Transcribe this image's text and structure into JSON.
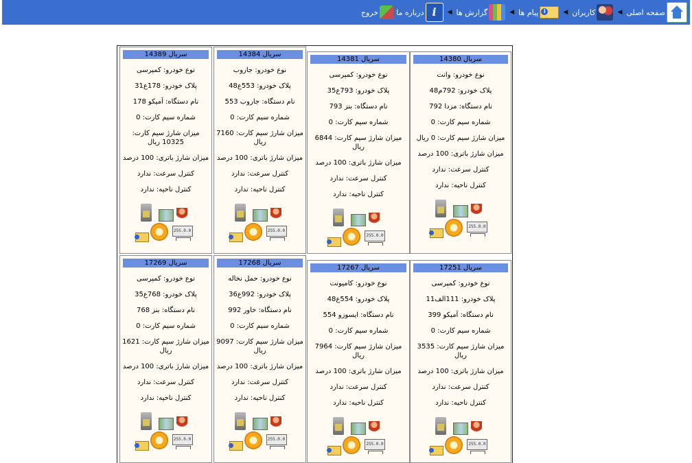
{
  "nav": {
    "home": "صفحه اصلی",
    "users": "کاربران",
    "messages": "پیام ها",
    "reports": "گزارش ها",
    "about": "درباره ما",
    "exit": "خروج",
    "about_glyph": "i"
  },
  "labels": {
    "type": "نوع خودرو:",
    "plate": "پلاک خودرو:",
    "device": "نام دستگاه:",
    "sim": "شماره سیم کارت:",
    "charge": "میزان شارژ سیم کارت:",
    "battery": "میزان شارژ باتری:",
    "speed": "کنترل سرعت:",
    "zone": "کنترل ناحیه:",
    "net": "255.0.0"
  },
  "cards": [
    {
      "title": "سریال 14389",
      "type": "کمپرسی",
      "plate": "178ع31",
      "device": "آمیکو 178",
      "sim": "0",
      "charge": "10325 ریال",
      "battery": "100 درصد",
      "speed": "ندارد",
      "zone": "ندارد"
    },
    {
      "title": "سریال 14384",
      "type": "جاروب",
      "plate": "553ع48",
      "device": "جاروب 553",
      "sim": "0",
      "charge": "7160 ریال",
      "battery": "100 درصد",
      "speed": "ندارد",
      "zone": "ندارد"
    },
    {
      "title": "سریال 14381",
      "type": "کمپرسی",
      "plate": "793ع35",
      "device": "بنز 793",
      "sim": "0",
      "charge": "6844 ریال",
      "battery": "100 درصد",
      "speed": "ندارد",
      "zone": "ندارد"
    },
    {
      "title": "سریال 14380",
      "type": "وانت",
      "plate": "792م48",
      "device": "مزدا 792",
      "sim": "0",
      "charge": "0 ریال",
      "battery": "100 درصد",
      "speed": "ندارد",
      "zone": "ندارد"
    },
    {
      "title": "سریال 17269",
      "type": "کمپرسی",
      "plate": "768ع35",
      "device": "بنز 768",
      "sim": "0",
      "charge": "1621 ریال",
      "battery": "100 درصد",
      "speed": "ندارد",
      "zone": "ندارد"
    },
    {
      "title": "سریال 17268",
      "type": "حمل نخاله",
      "plate": "992ع36",
      "device": "خاور 992",
      "sim": "0",
      "charge": "9097 ریال",
      "battery": "100 درصد",
      "speed": "ندارد",
      "zone": "ندارد"
    },
    {
      "title": "سریال 17267",
      "type": "کامیونت",
      "plate": "554ع48",
      "device": "ایسوزو 554",
      "sim": "0",
      "charge": "7964 ریال",
      "battery": "100 درصد",
      "speed": "ندارد",
      "zone": "ندارد"
    },
    {
      "title": "سریال 17251",
      "type": "کمپرسی",
      "plate": "111الف11",
      "device": "آمیکو 399",
      "sim": "0",
      "charge": "3535 ریال",
      "battery": "100 درصد",
      "speed": "ندارد",
      "zone": "ندارد"
    }
  ]
}
